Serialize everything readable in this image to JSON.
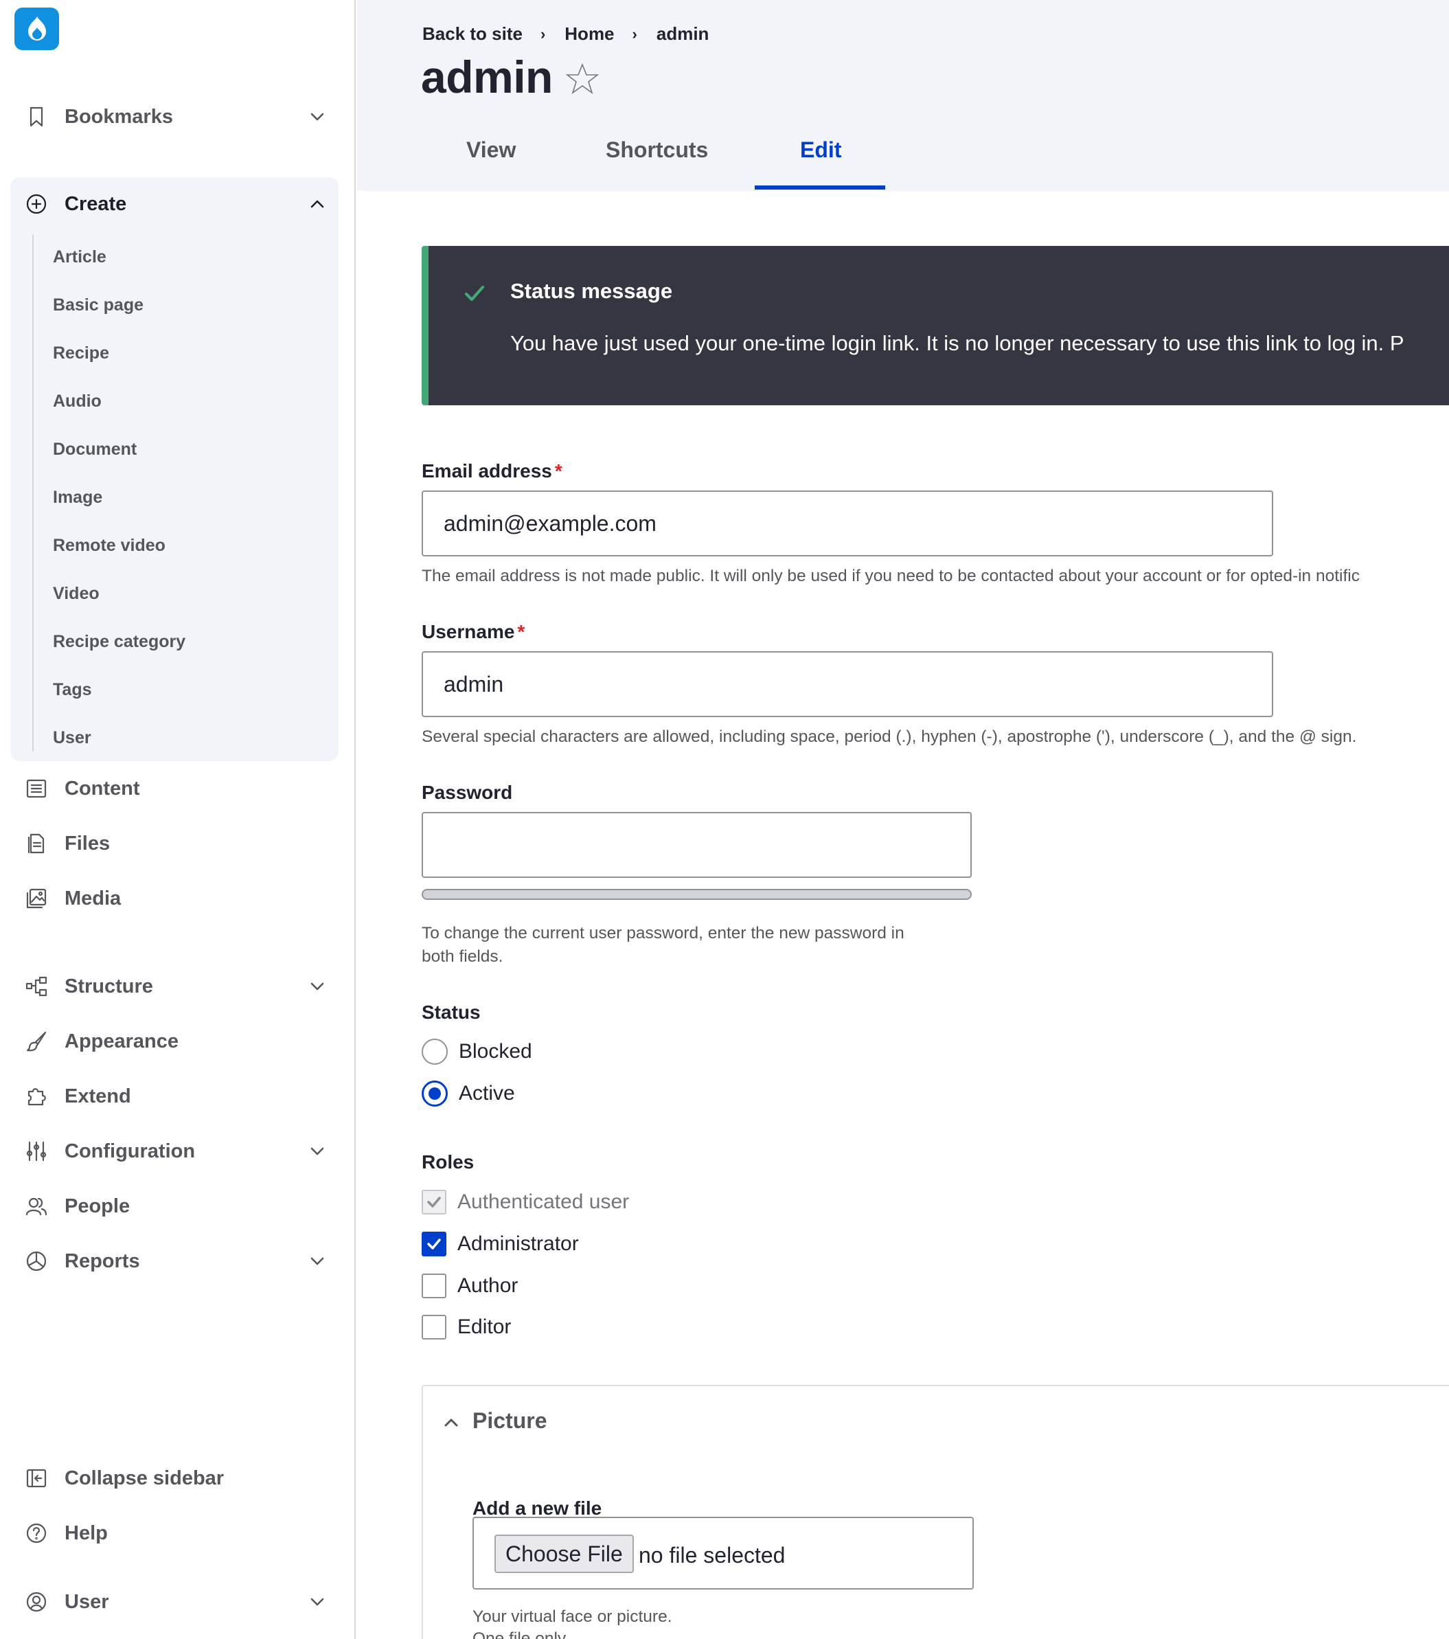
{
  "sidebar": {
    "bookmarks": "Bookmarks",
    "create": {
      "label": "Create",
      "items": [
        "Article",
        "Basic page",
        "Recipe",
        "Audio",
        "Document",
        "Image",
        "Remote video",
        "Video",
        "Recipe category",
        "Tags",
        "User"
      ]
    },
    "content": "Content",
    "files": "Files",
    "media": "Media",
    "structure": "Structure",
    "appearance": "Appearance",
    "extend": "Extend",
    "configuration": "Configuration",
    "people": "People",
    "reports": "Reports",
    "collapse": "Collapse sidebar",
    "help": "Help",
    "user": "User"
  },
  "header": {
    "breadcrumb": [
      "Back to site",
      "Home",
      "admin"
    ],
    "breadcrumb_separator": "›",
    "title": "admin",
    "tabs": [
      "View",
      "Shortcuts",
      "Edit"
    ],
    "active_tab": "Edit"
  },
  "status": {
    "title": "Status message",
    "text": "You have just used your one-time login link. It is no longer necessary to use this link to log in. P"
  },
  "form": {
    "email": {
      "label": "Email address",
      "required_marker": "*",
      "value": "admin@example.com",
      "description": "The email address is not made public. It will only be used if you need to be contacted about your account or for opted-in notific"
    },
    "username": {
      "label": "Username",
      "required_marker": "*",
      "value": "admin",
      "description": "Several special characters are allowed, including space, period (.), hyphen (-), apostrophe ('), underscore (_), and the @ sign."
    },
    "password": {
      "label": "Password",
      "value": "",
      "description_line1": "To change the current user password, enter the new password in",
      "description_line2": "both fields."
    },
    "status": {
      "label": "Status",
      "options": [
        "Blocked",
        "Active"
      ],
      "selected": "Active"
    },
    "roles": {
      "label": "Roles",
      "options": [
        {
          "label": "Authenticated user",
          "checked": true,
          "disabled": true
        },
        {
          "label": "Administrator",
          "checked": true,
          "disabled": false
        },
        {
          "label": "Author",
          "checked": false,
          "disabled": false
        },
        {
          "label": "Editor",
          "checked": false,
          "disabled": false
        }
      ]
    },
    "picture": {
      "title": "Picture",
      "file_label": "Add a new file",
      "button": "Choose File",
      "file_status": "no file selected",
      "desc_line1": "Your virtual face or picture.",
      "desc_line2": "One file only."
    }
  },
  "colors": {
    "accent": "#003ecc",
    "logo": "#0f90e0",
    "status_bg": "#353641",
    "status_border": "#42a877",
    "required": "#dc2323",
    "header_bg": "#f3f4f9"
  },
  "icons": [
    "drupal-logo-icon",
    "bookmark-icon",
    "plus-circle-icon",
    "content-icon",
    "files-icon",
    "media-icon",
    "structure-icon",
    "appearance-icon",
    "extend-icon",
    "configuration-icon",
    "people-icon",
    "reports-icon",
    "collapse-sidebar-icon",
    "help-icon",
    "user-icon",
    "chevron-down-icon",
    "chevron-up-icon",
    "star-icon",
    "check-icon"
  ]
}
